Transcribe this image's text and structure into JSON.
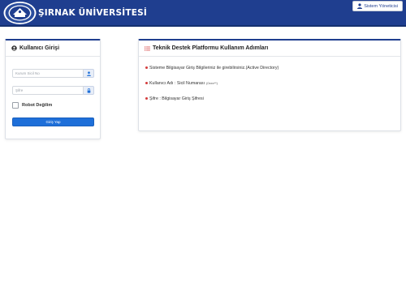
{
  "header": {
    "brand": "ŞIRNAK ÜNİVERSİTESİ",
    "admin_button": "Sistem Yöneticisi",
    "colors": {
      "bar": "#1f3e8f",
      "text": "#ffffff"
    }
  },
  "login": {
    "title": "Kullanıcı Girişi",
    "username_placeholder": "Kurum Sicil No",
    "username_value": "",
    "password_placeholder": "Şifre",
    "password_value": "",
    "captcha_label": "Robot Değilim",
    "submit_label": "Giriş Yap",
    "colors": {
      "button": "#1e6fd9"
    }
  },
  "info": {
    "title": "Teknik Destek Platformu Kullanım Adımları",
    "items": [
      {
        "text": "Sisteme Bilgisayar Giriş Bilgileriniz ile girebilirsiniz.(Active Directory)",
        "hint": ""
      },
      {
        "text": "Kullanıcı Adı : Sicil Numarası",
        "hint": "(0xxx**)"
      },
      {
        "text": "Şifre : Bilgisayar Giriş Şifresi",
        "hint": ""
      }
    ],
    "colors": {
      "bullet": "#d43c3c",
      "icon": "#d43c3c"
    }
  },
  "icons": {
    "logo": "university-seal-logo",
    "admin": "user-icon",
    "panel_login": "user-circle-icon",
    "username_addon": "user-icon",
    "password_addon": "lock-icon",
    "panel_info": "list-icon"
  }
}
